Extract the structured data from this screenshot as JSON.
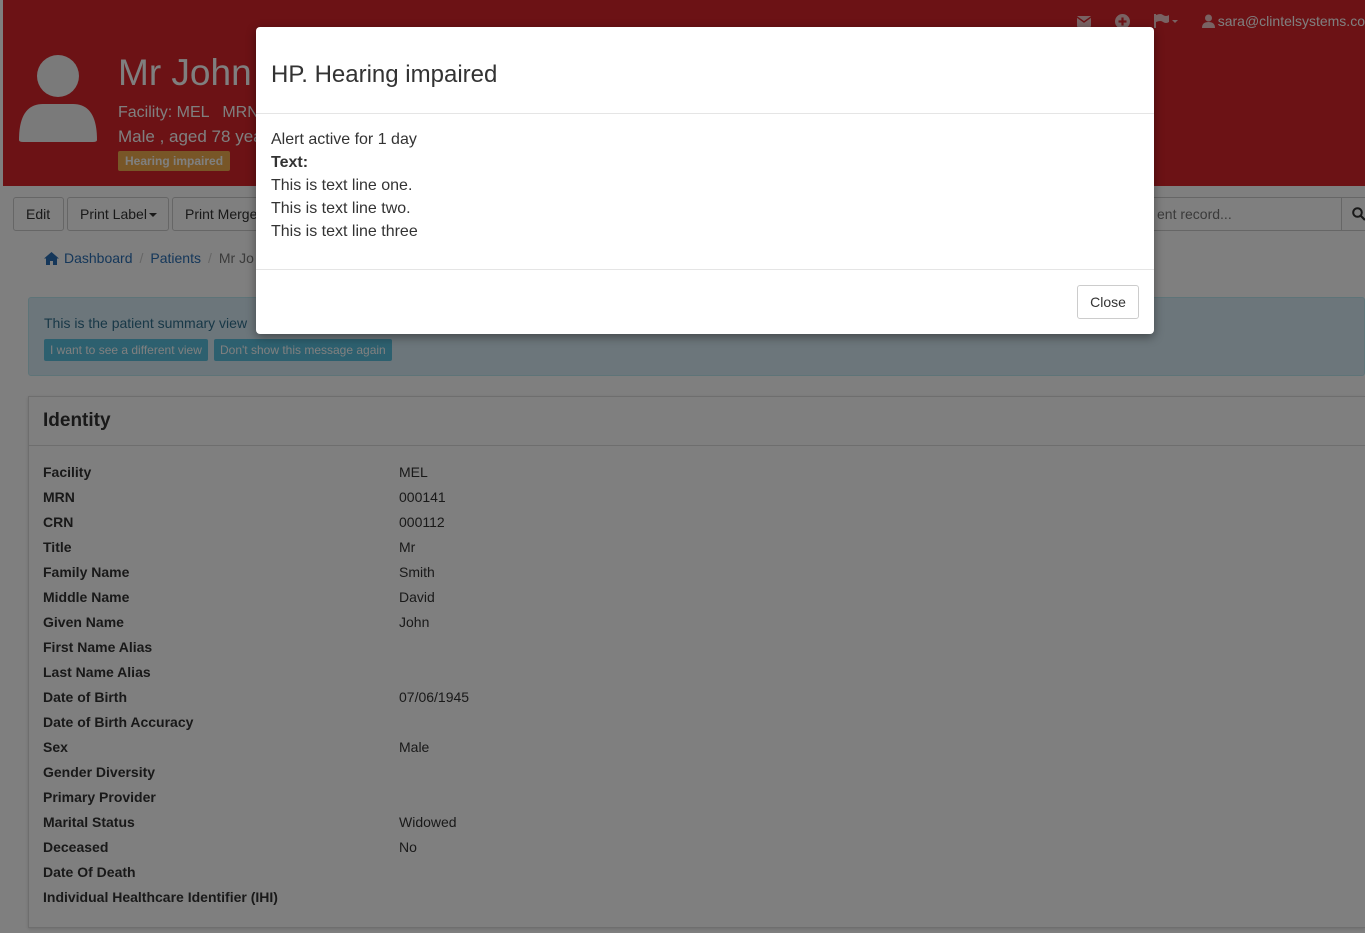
{
  "header": {
    "user_email": "sara@clintelsystems.co",
    "patient_name": "Mr John",
    "facility_line": "Facility: MEL   MRN",
    "demographics": "Male , aged 78 year",
    "alert_badge": "Hearing impaired",
    "icons": [
      "envelope-icon",
      "plus-circle-icon",
      "flag-icon",
      "user-icon"
    ],
    "bg_color": "#d9252a"
  },
  "toolbar": {
    "edit": "Edit",
    "print_label": "Print Label",
    "print_merge": "Print Merge",
    "search_placeholder": "ent record..."
  },
  "breadcrumb": {
    "dashboard": "Dashboard",
    "patients": "Patients",
    "current": "Mr Jo"
  },
  "info": {
    "message": "This is the patient summary view",
    "btn_different_view": "I want to see a different view",
    "btn_dont_show": "Don't show this message again"
  },
  "identity": {
    "title": "Identity",
    "rows": [
      {
        "label": "Facility",
        "value": "MEL"
      },
      {
        "label": "MRN",
        "value": "000141"
      },
      {
        "label": "CRN",
        "value": "000112"
      },
      {
        "label": "Title",
        "value": "Mr"
      },
      {
        "label": "Family Name",
        "value": "Smith"
      },
      {
        "label": "Middle Name",
        "value": "David"
      },
      {
        "label": "Given Name",
        "value": "John"
      },
      {
        "label": "First Name Alias",
        "value": ""
      },
      {
        "label": "Last Name Alias",
        "value": ""
      },
      {
        "label": "Date of Birth",
        "value": "07/06/1945"
      },
      {
        "label": "Date of Birth Accuracy",
        "value": ""
      },
      {
        "label": "Sex",
        "value": "Male"
      },
      {
        "label": "Gender Diversity",
        "value": ""
      },
      {
        "label": "Primary Provider",
        "value": ""
      },
      {
        "label": "Marital Status",
        "value": "Widowed"
      },
      {
        "label": "Deceased",
        "value": "No"
      },
      {
        "label": "Date Of Death",
        "value": ""
      },
      {
        "label": "Individual Healthcare Identifier (IHI)",
        "value": ""
      }
    ]
  },
  "modal": {
    "title": "HP. Hearing impaired",
    "active_for": "Alert active for 1 day",
    "text_label": "Text:",
    "lines": [
      "This is text line one.",
      "This is text line two.",
      "This is text line three"
    ],
    "close": "Close"
  }
}
